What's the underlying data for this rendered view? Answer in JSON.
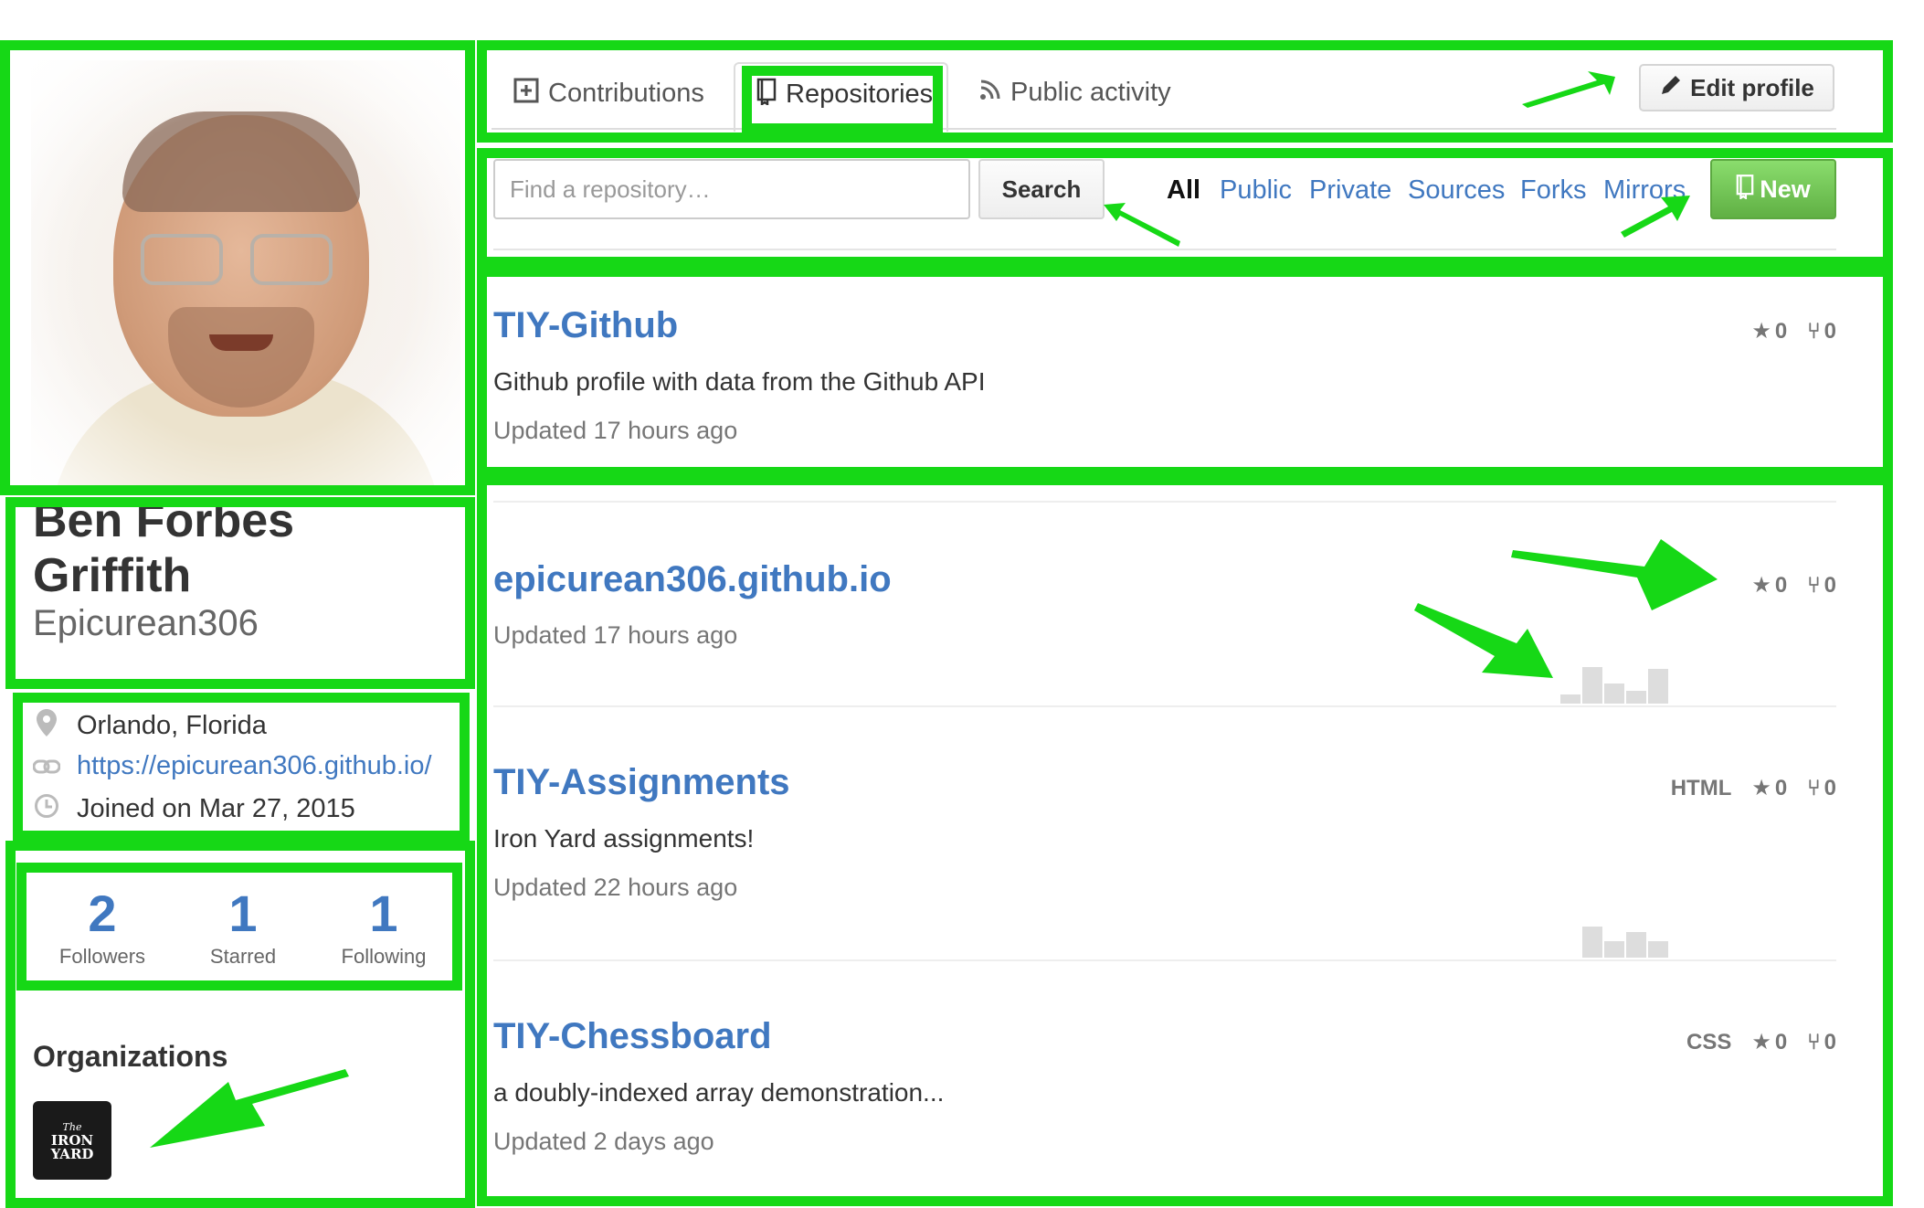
{
  "profile": {
    "name": "Ben Forbes Griffith",
    "username": "Epicurean306",
    "location": "Orlando, Florida",
    "website": "https://epicurean306.github.io/",
    "joined": "Joined on Mar 27, 2015",
    "icons": {
      "location": "map-pin-icon",
      "link": "link-icon",
      "clock": "clock-icon"
    }
  },
  "stats": [
    {
      "value": "2",
      "label": "Followers"
    },
    {
      "value": "1",
      "label": "Starred"
    },
    {
      "value": "1",
      "label": "Following"
    }
  ],
  "organizations": {
    "title": "Organizations",
    "logo_text": [
      "The",
      "IRON",
      "YARD"
    ]
  },
  "tabs": [
    {
      "label": "Contributions",
      "icon": "plus-square-icon",
      "active": false
    },
    {
      "label": "Repositories",
      "icon": "repo-book-icon",
      "active": true
    },
    {
      "label": "Public activity",
      "icon": "rss-icon",
      "active": false
    }
  ],
  "edit_profile": "Edit profile",
  "search": {
    "placeholder": "Find a repository…",
    "button": "Search"
  },
  "filters": [
    "All",
    "Public",
    "Private",
    "Sources",
    "Forks",
    "Mirrors"
  ],
  "active_filter": "All",
  "new_button": "New",
  "repos": [
    {
      "name": "TIY-Github",
      "description": "Github profile with data from the Github API",
      "updated": "Updated 17 hours ago",
      "language": "",
      "stars": "0",
      "forks": "0"
    },
    {
      "name": "epicurean306.github.io",
      "description": "",
      "updated": "Updated 17 hours ago",
      "language": "",
      "stars": "0",
      "forks": "0"
    },
    {
      "name": "TIY-Assignments",
      "description": "Iron Yard assignments!",
      "updated": "Updated 22 hours ago",
      "language": "HTML",
      "stars": "0",
      "forks": "0"
    },
    {
      "name": "TIY-Chessboard",
      "description": "a doubly-indexed array demonstration...",
      "updated": "Updated 2 days ago",
      "language": "CSS",
      "stars": "0",
      "forks": "0"
    }
  ],
  "colors": {
    "annotation": "#16d816",
    "link": "#4078c0",
    "new_button": "#6cc644"
  }
}
